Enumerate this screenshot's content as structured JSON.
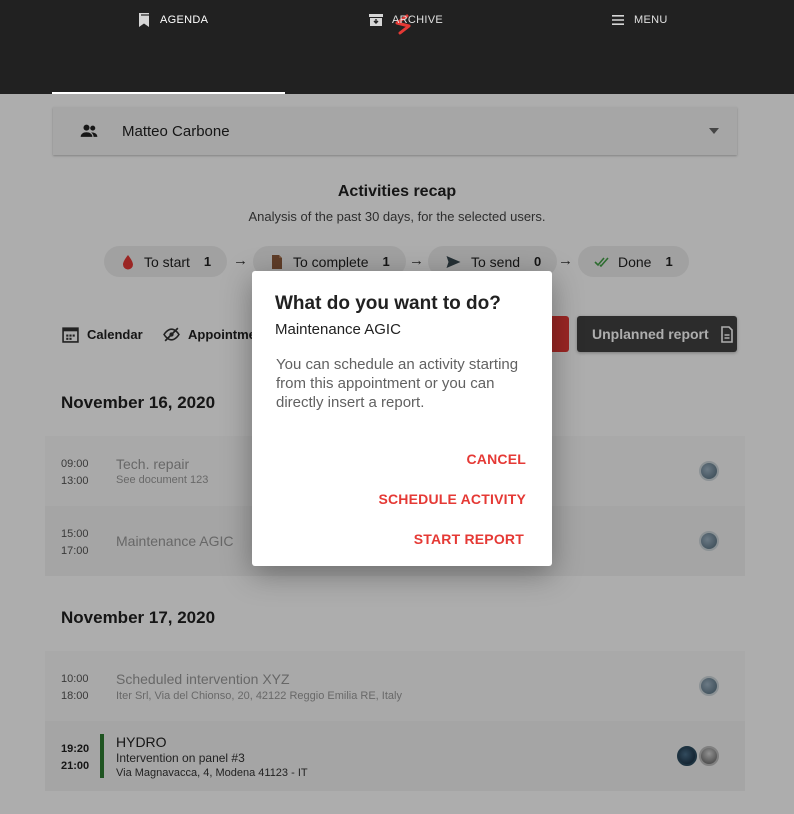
{
  "header": {
    "logo_icon": "s-logo-icon",
    "tabs": [
      {
        "label": "AGENDA",
        "icon": "bookmark-icon",
        "active": true
      },
      {
        "label": "ARCHIVE",
        "icon": "archive-icon",
        "active": false
      },
      {
        "label": "MENU",
        "icon": "hamburger-icon",
        "active": false
      }
    ]
  },
  "user_filter": {
    "name": "Matteo Carbone",
    "icon": "people-icon"
  },
  "recap": {
    "title": "Activities recap",
    "subtitle": "Analysis of the past 30 days, for the selected users.",
    "statuses": [
      {
        "label": "To start",
        "count": "1",
        "icon": "drop-icon",
        "color": "#e53935"
      },
      {
        "label": "To complete",
        "count": "1",
        "icon": "document-icon",
        "color": "#8d5a3b"
      },
      {
        "label": "To send",
        "count": "0",
        "icon": "send-icon",
        "color": "#37474f"
      },
      {
        "label": "Done",
        "count": "1",
        "icon": "double-check-icon",
        "color": "#43a047"
      }
    ]
  },
  "toolbar": {
    "calendar_label": "Calendar",
    "appointments_label": "Appointme",
    "unplanned_label": "Unplanned report"
  },
  "days": [
    {
      "date": "November 16, 2020",
      "items": [
        {
          "start": "09:00",
          "end": "13:00",
          "title": "Tech. repair",
          "subtitle": "See document 123",
          "address": ""
        },
        {
          "start": "15:00",
          "end": "17:00",
          "title": "Maintenance AGIC",
          "subtitle": "",
          "address": ""
        }
      ]
    },
    {
      "date": "November 17, 2020",
      "items": [
        {
          "start": "10:00",
          "end": "18:00",
          "title": "Scheduled intervention XYZ",
          "subtitle": "Iter Srl, Via del Chionso, 20, 42122 Reggio Emilia RE, Italy",
          "address": ""
        },
        {
          "start": "19:20",
          "end": "21:00",
          "title": "HYDRO",
          "subtitle": "Intervention on panel #3",
          "address": "Via Magnavacca, 4, Modena 41123 - IT"
        }
      ]
    }
  ],
  "dialog": {
    "title": "What do you want to do?",
    "subtitle": "Maintenance AGIC",
    "body": "You can schedule an activity starting from this appointment or you can directly insert a report.",
    "actions": {
      "cancel": "CANCEL",
      "schedule": "SCHEDULE ACTIVITY",
      "start": "START REPORT"
    },
    "accent_color": "#e53935"
  }
}
